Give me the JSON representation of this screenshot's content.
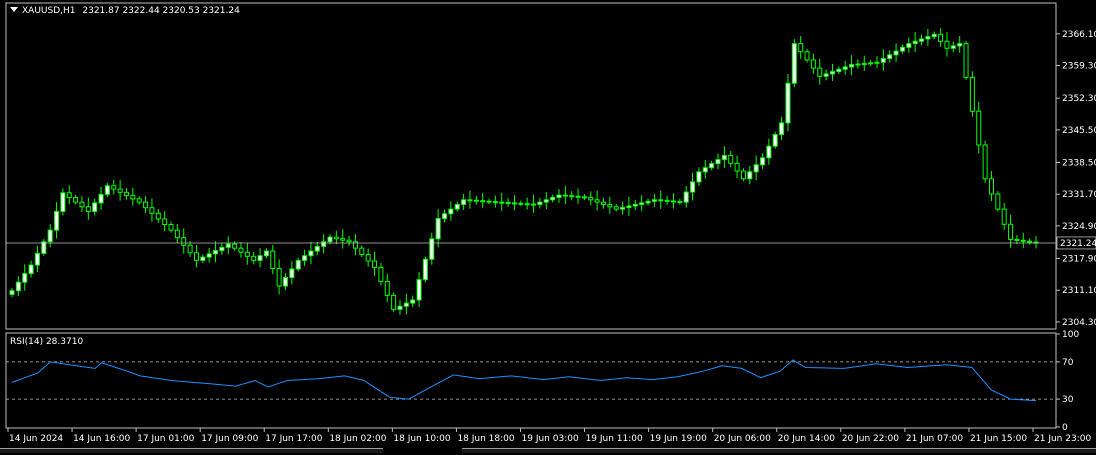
{
  "colors": {
    "background": "#000000",
    "frame": "#c0c0c0",
    "bull_candle_body": "#ffffff",
    "bear_candle_body": "#000000",
    "candle_outline": "#00ff00",
    "price_line": "#c0c0c0",
    "rsi_line": "#1e90ff",
    "rsi_level": "#c0c0c0",
    "text": "#ffffff"
  },
  "header": {
    "arrow_icon": "triangle-down-icon",
    "symbol": "XAUUSD,H1",
    "ohlc": "2321.87 2322.44 2320.53 2321.24"
  },
  "rsi_header": {
    "label": "RSI(14) 28.3710"
  },
  "chart_data": [
    {
      "type": "candlestick",
      "symbol": "XAUUSD",
      "timeframe": "H1",
      "y_ticks": [
        "2366.10",
        "2359.30",
        "2352.30",
        "2345.50",
        "2338.50",
        "2331.70",
        "2324.90",
        "2317.90",
        "2311.10",
        "2304.30"
      ],
      "ylim": [
        2303.0,
        2372.5
      ],
      "current_price": "2321.24",
      "x_ticks": [
        "14 Jun 2024",
        "14 Jun 16:00",
        "17 Jun 01:00",
        "17 Jun 09:00",
        "17 Jun 17:00",
        "18 Jun 02:00",
        "18 Jun 10:00",
        "18 Jun 18:00",
        "19 Jun 03:00",
        "19 Jun 11:00",
        "19 Jun 19:00",
        "20 Jun 06:00",
        "20 Jun 14:00",
        "20 Jun 22:00",
        "21 Jun 07:00",
        "21 Jun 15:00",
        "21 Jun 23:00"
      ],
      "anchor_points": [
        [
          0,
          2311.0
        ],
        [
          3,
          2316.5
        ],
        [
          6,
          2324.0
        ],
        [
          8,
          2332.0
        ],
        [
          12,
          2328.0
        ],
        [
          15,
          2333.5
        ],
        [
          20,
          2330.0
        ],
        [
          25,
          2324.0
        ],
        [
          29,
          2317.5
        ],
        [
          34,
          2321.0
        ],
        [
          38,
          2317.5
        ],
        [
          40,
          2319.5
        ],
        [
          42,
          2312.0
        ],
        [
          45,
          2317.5
        ],
        [
          50,
          2322.5
        ],
        [
          53,
          2321.5
        ],
        [
          57,
          2316.0
        ],
        [
          60,
          2307.0
        ],
        [
          63,
          2309.0
        ],
        [
          67,
          2326.5
        ],
        [
          71,
          2330.5
        ],
        [
          76,
          2330.0
        ],
        [
          82,
          2329.5
        ],
        [
          86,
          2331.5
        ],
        [
          90,
          2331.0
        ],
        [
          95,
          2328.5
        ],
        [
          101,
          2330.5
        ],
        [
          105,
          2330.0
        ],
        [
          108,
          2336.5
        ],
        [
          112,
          2340.0
        ],
        [
          115,
          2335.0
        ],
        [
          118,
          2339.5
        ],
        [
          121,
          2347.0
        ],
        [
          123,
          2364.0
        ],
        [
          127,
          2357.0
        ],
        [
          132,
          2359.5
        ],
        [
          136,
          2360.0
        ],
        [
          141,
          2364.0
        ],
        [
          145,
          2366.0
        ],
        [
          147,
          2363.0
        ],
        [
          149,
          2364.0
        ],
        [
          153,
          2335.0
        ],
        [
          157,
          2322.0
        ],
        [
          161,
          2321.24
        ]
      ]
    },
    {
      "type": "line",
      "name": "RSI(14)",
      "value": "28.3710",
      "y_ticks": [
        "100",
        "70",
        "30",
        "0"
      ],
      "levels": [
        70,
        30
      ],
      "ylim": [
        0,
        100
      ],
      "anchor_points": [
        [
          0,
          48
        ],
        [
          4,
          58
        ],
        [
          6,
          70
        ],
        [
          10,
          66
        ],
        [
          13,
          63
        ],
        [
          14,
          69
        ],
        [
          18,
          60
        ],
        [
          20,
          55
        ],
        [
          25,
          50
        ],
        [
          30,
          47
        ],
        [
          35,
          44
        ],
        [
          38,
          50
        ],
        [
          40,
          43
        ],
        [
          43,
          50
        ],
        [
          48,
          52
        ],
        [
          52,
          55
        ],
        [
          55,
          50
        ],
        [
          59,
          32
        ],
        [
          62,
          30
        ],
        [
          66,
          45
        ],
        [
          69,
          56
        ],
        [
          73,
          52
        ],
        [
          78,
          55
        ],
        [
          83,
          51
        ],
        [
          87,
          54
        ],
        [
          92,
          50
        ],
        [
          96,
          53
        ],
        [
          100,
          51
        ],
        [
          104,
          54
        ],
        [
          108,
          60
        ],
        [
          111,
          66
        ],
        [
          114,
          63
        ],
        [
          117,
          53
        ],
        [
          120,
          60
        ],
        [
          122,
          72
        ],
        [
          124,
          64
        ],
        [
          130,
          63
        ],
        [
          135,
          68
        ],
        [
          140,
          64
        ],
        [
          146,
          67
        ],
        [
          150,
          64
        ],
        [
          153,
          40
        ],
        [
          156,
          30
        ],
        [
          160,
          28.371
        ]
      ]
    }
  ]
}
